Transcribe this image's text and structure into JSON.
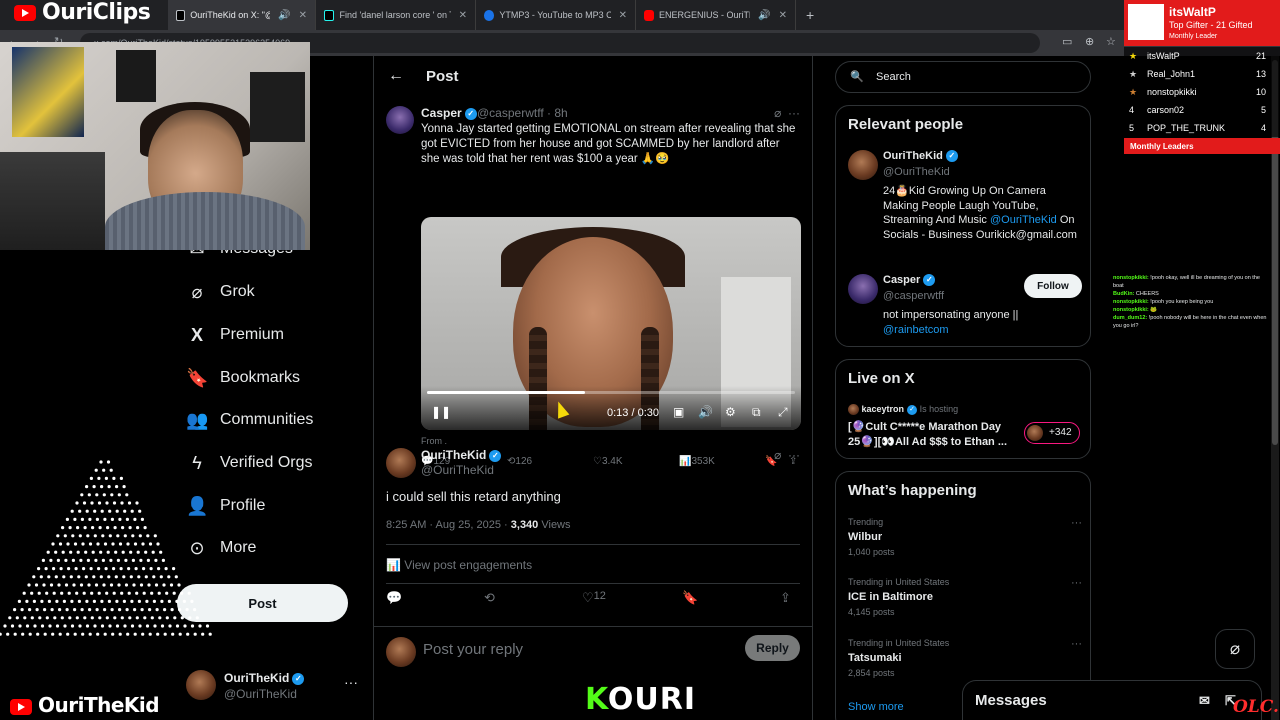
{
  "browser": {
    "tabs": [
      {
        "title": "OuriTheKid on X: \"@caspe",
        "icon_color": "#e7e9ea",
        "active": true
      },
      {
        "title": "Find 'danel larson core ' on Tik",
        "icon_color": "#25f4ee",
        "active": false
      },
      {
        "title": "YTMP3 - YouTube to MP3 Conv",
        "icon_color": "#1a73e8",
        "active": false
      },
      {
        "title": "ENERGENIUS - OuriTheKid",
        "icon_color": "#ff0000",
        "active": false
      }
    ],
    "url": "x.com/OuriTheKid/status/1959955315396354069"
  },
  "nav": {
    "items": [
      {
        "label": "Messages",
        "icon": "envelope-icon"
      },
      {
        "label": "Grok",
        "icon": "grok-icon"
      },
      {
        "label": "Premium",
        "icon": "x-logo-icon"
      },
      {
        "label": "Bookmarks",
        "icon": "bookmark-icon"
      },
      {
        "label": "Communities",
        "icon": "communities-icon"
      },
      {
        "label": "Verified Orgs",
        "icon": "lightning-icon"
      },
      {
        "label": "Profile",
        "icon": "person-icon"
      },
      {
        "label": "More",
        "icon": "more-circle-icon"
      }
    ],
    "post_button": "Post",
    "account": {
      "name": "OuriTheKid",
      "handle": "@OuriTheKid"
    }
  },
  "main": {
    "header_title": "Post",
    "quoted": {
      "name": "Casper",
      "handle_time": "@casperwtff · 8h",
      "text": "Yonna Jay started getting EMOTIONAL on stream after revealing that she got EVICTED from her house and got SCAMMED by her landlord after she was told that her rent was $100 a year 🙏🥹",
      "video_time": "0:13 / 0:30",
      "video_progress": 0.43,
      "from": "From .",
      "stats": {
        "replies": "129",
        "reposts": "126",
        "likes": "3.4K",
        "views": "353K"
      }
    },
    "tweet": {
      "name": "OuriTheKid",
      "handle": "@OuriTheKid",
      "text": "i could sell this retard anything",
      "timestamp": "8:25 AM · Aug 25, 2025 ·",
      "views_count": "3,340",
      "views_label": "Views",
      "engagements": "View post engagements",
      "likes": "12"
    },
    "reply": {
      "placeholder": "Post your reply",
      "button": "Reply"
    }
  },
  "sidebar": {
    "search_placeholder": "Search",
    "relevant_title": "Relevant people",
    "people": [
      {
        "name": "OuriTheKid",
        "handle": "@OuriTheKid",
        "bio_start": "24🎂Kid Growing Up On Camera Making People Laugh YouTube, Streaming And Music ",
        "bio_link": "@OuriTheKid",
        "bio_end": " On Socials - Business Ourikick@gmail.com"
      },
      {
        "name": "Casper",
        "handle": "@casperwtff",
        "bio_start": "not impersonating anyone || ",
        "bio_link": "@rainbetcom",
        "bio_end": "",
        "follow": "Follow"
      }
    ],
    "live_title": "Live on X",
    "live": {
      "host": "kaceytron",
      "hosting": "Is hosting",
      "title_line1": "[🔮Cult C*****e Marathon Day",
      "title_line2": "25🔮][👀All Ad $$$ to Ethan ...",
      "viewers": "+342"
    },
    "happening_title": "What’s happening",
    "trends": [
      {
        "meta": "Trending",
        "name": "Wilbur",
        "count": "1,040 posts"
      },
      {
        "meta": "Trending in United States",
        "name": "ICE in Baltimore",
        "count": "4,145 posts"
      },
      {
        "meta": "Trending in United States",
        "name": "Tatsumaki",
        "count": "2,854 posts"
      }
    ],
    "show_more": "Show more",
    "messages": "Messages"
  },
  "stream": {
    "brand": "OuriClips",
    "channel": "OuriTheKid",
    "kouri": "OURI",
    "kouri_k": "K",
    "top_gifter": {
      "name": "itsWaltP",
      "line": "Top Gifter - 21 Gifted",
      "sub": "Monthly Leader"
    },
    "leaders": [
      {
        "rank": "★",
        "name": "itsWaltP",
        "count": "21"
      },
      {
        "rank": "★",
        "name": "Real_John1",
        "count": "13"
      },
      {
        "rank": "★",
        "name": "nonstopkikki",
        "count": "10"
      },
      {
        "rank": "4",
        "name": "carson02",
        "count": "5"
      },
      {
        "rank": "5",
        "name": "POP_THE_TRUNK",
        "count": "4"
      }
    ],
    "leaders_footer": "Monthly Leaders",
    "chat": [
      {
        "user": "nonstopkikki:",
        "msg": " !pooh okay, well ill be dreaming of you on the boat"
      },
      {
        "user": "BudKin:",
        "msg": " CHEERS"
      },
      {
        "user": "nonstopkikki:",
        "msg": " !pooh you keep being you"
      },
      {
        "user": "nonstopkikki:",
        "msg": " 🐸"
      },
      {
        "user": "dum_dum12:",
        "msg": " !pooh nobody will be here in the chat even when you go irl?"
      }
    ],
    "watermark": "OLC."
  }
}
